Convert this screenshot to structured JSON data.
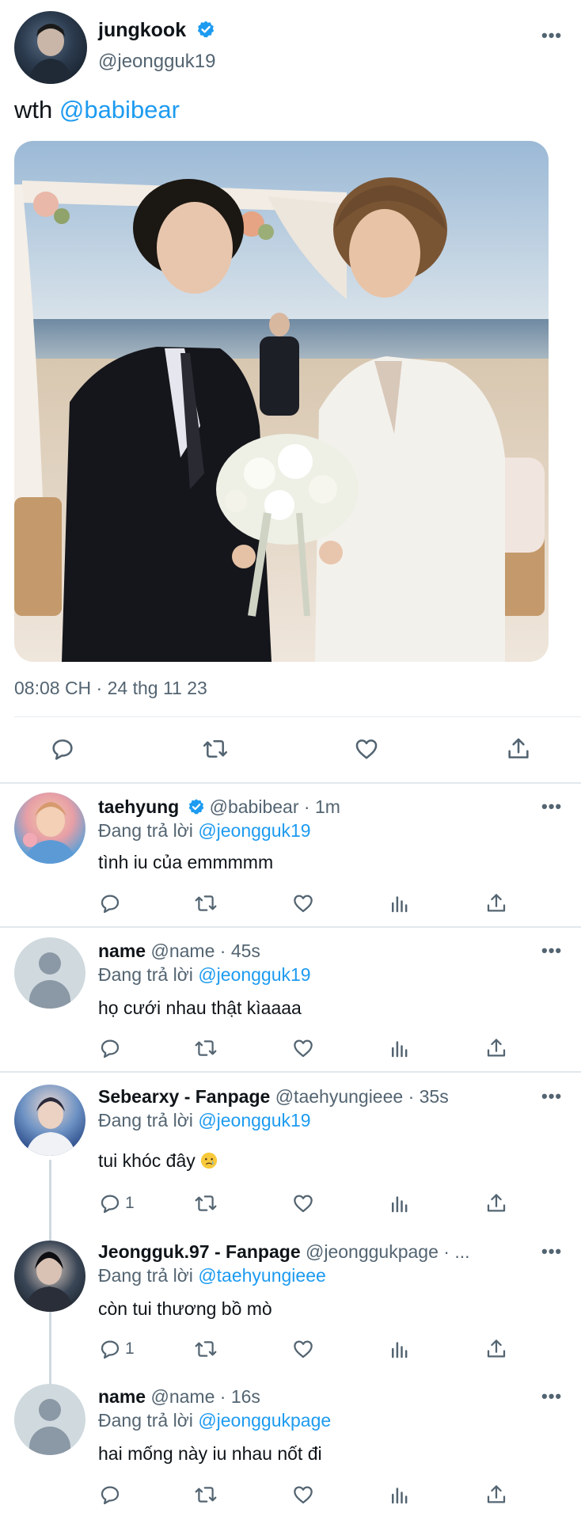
{
  "main": {
    "name": "jungkook",
    "handle": "@jeongguk19",
    "text_prefix": "wth ",
    "mention": "@babibear",
    "timestamp": "08:08 CH · 24 thg 11 23",
    "more": "•••"
  },
  "replies": [
    {
      "name": "taehyung",
      "handle": "@babibear",
      "sep": " · ",
      "time": "1m",
      "replying_label": "Đang trả lời ",
      "replying_to": "@jeongguk19",
      "text": "tình iu của emmmmm",
      "reply_count": "",
      "verified": true
    },
    {
      "name": "name",
      "handle": "@name",
      "sep": " · ",
      "time": "45s",
      "replying_label": "Đang trả lời ",
      "replying_to": "@jeongguk19",
      "text": "họ cưới nhau thật kìaaaa",
      "reply_count": "",
      "verified": false
    },
    {
      "name": "Sebearxy - Fanpage",
      "handle": "@taehyungieee",
      "sep": " · ",
      "time": "35s",
      "replying_label": "Đang trả lời ",
      "replying_to": "@jeongguk19",
      "text": "tui khóc đây",
      "reply_count": "1",
      "verified": false
    },
    {
      "name": "Jeongguk.97 - Fanpage",
      "handle": "@jeonggukpage",
      "sep": " · ...",
      "time": "",
      "replying_label": "Đang trả lời ",
      "replying_to": "@taehyungieee",
      "text": "còn tui thương bồ mò",
      "reply_count": "1",
      "verified": false
    },
    {
      "name": "name",
      "handle": "@name",
      "sep": " · ",
      "time": "16s",
      "replying_label": "Đang trả lời ",
      "replying_to": "@jeonggukpage",
      "text": "hai mống này iu nhau nốt đi",
      "reply_count": "",
      "verified": false
    }
  ],
  "icons": {
    "reply": "reply-icon",
    "retweet": "retweet-icon",
    "like": "heart-icon",
    "views": "views-icon",
    "share": "share-icon",
    "verified": "verified-badge-icon"
  },
  "colors": {
    "accent": "#1d9bf0",
    "secondary_text": "#536471",
    "primary_text": "#0f1419"
  }
}
